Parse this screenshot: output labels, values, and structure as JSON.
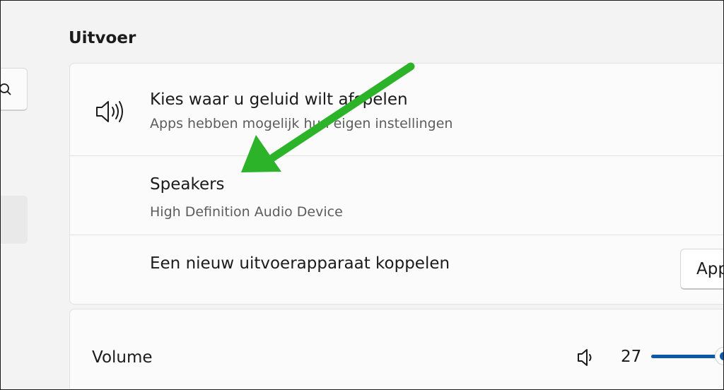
{
  "section": {
    "title": "Uitvoer"
  },
  "output_choice": {
    "title": "Kies waar u geluid wilt afspelen",
    "subtitle": "Apps hebben mogelijk hun eigen instellingen",
    "icon": "speaker-icon"
  },
  "device": {
    "name": "Speakers",
    "description": "High Definition Audio Device"
  },
  "pair_device": {
    "label": "Een nieuw uitvoerapparaat koppelen",
    "button_label": "App"
  },
  "volume": {
    "label": "Volume",
    "value": "27",
    "level_percent": 27,
    "icon": "volume-icon"
  },
  "annotation": {
    "arrow_color": "#2db32a"
  },
  "colors": {
    "accent": "#0f57a8",
    "background": "#f3f3f3",
    "card": "#fbfbfb"
  }
}
